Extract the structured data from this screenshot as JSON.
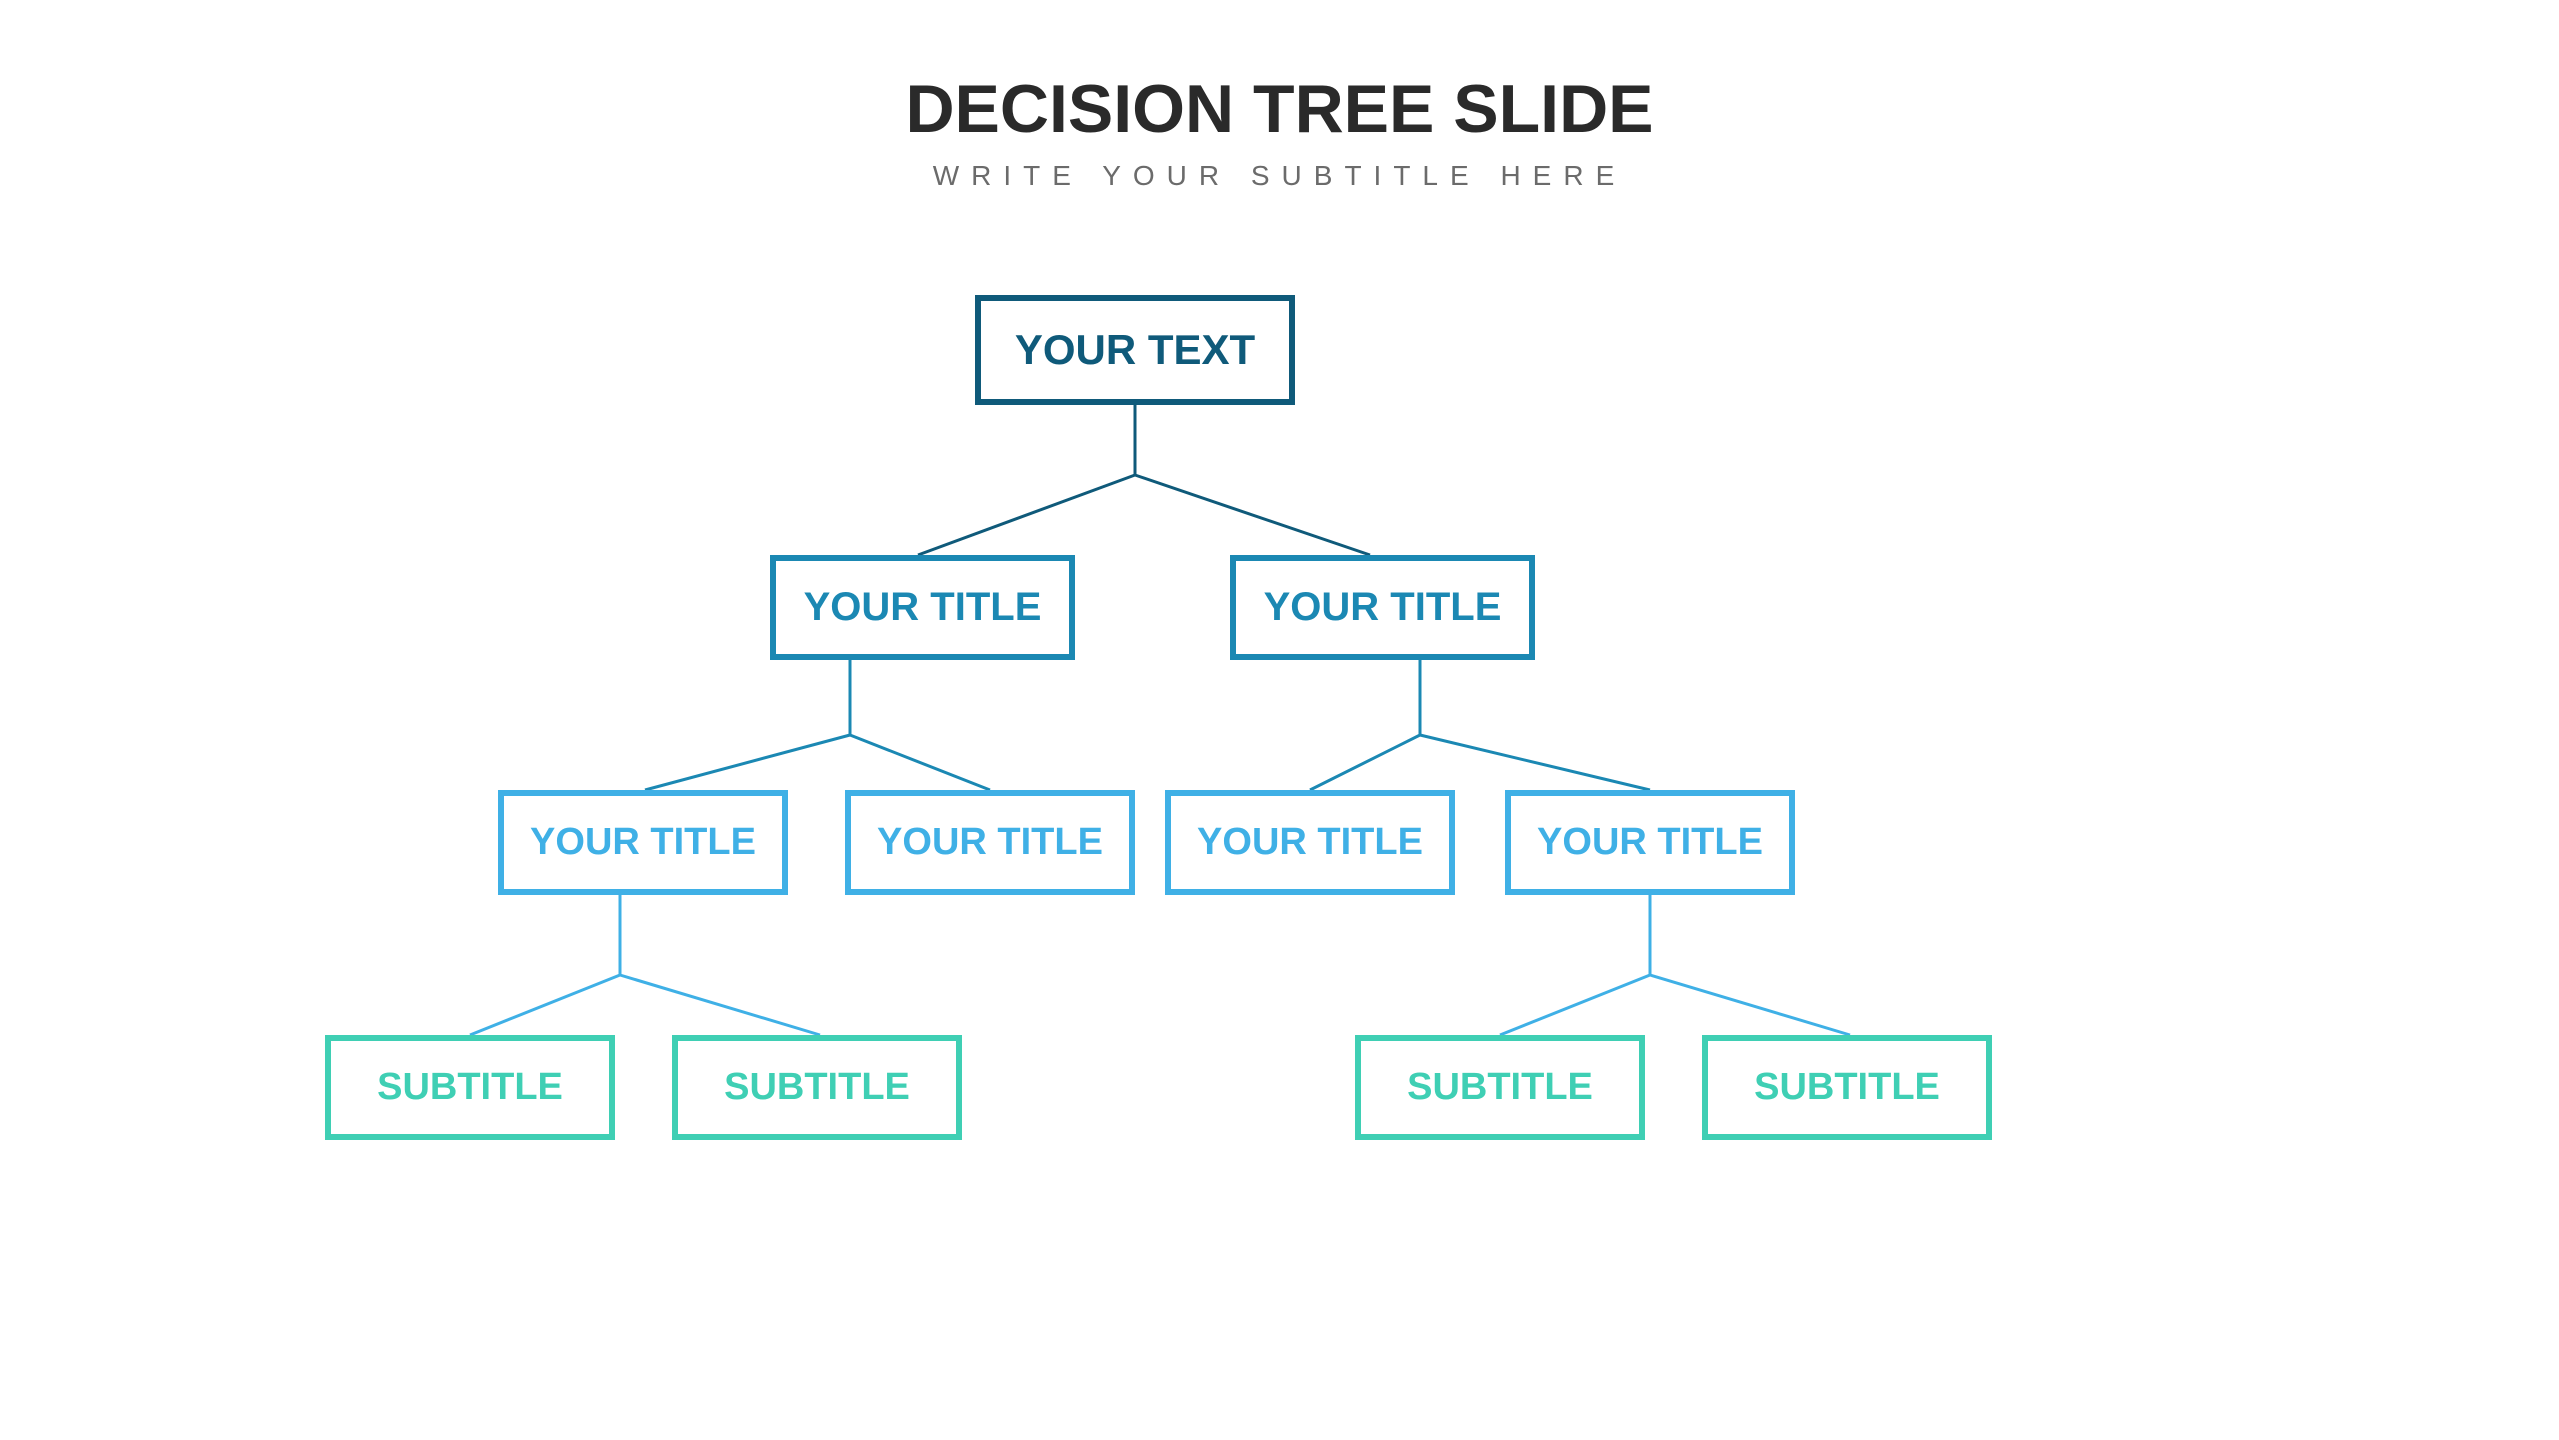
{
  "header": {
    "title": "DECISION TREE SLIDE",
    "subtitle": "WRITE YOUR SUBTITLE HERE"
  },
  "colors": {
    "level0": "#0f5a7a",
    "level1": "#1b88b3",
    "level2": "#3fb0e6",
    "level3": "#3fcfb4"
  },
  "tree": {
    "root": {
      "label": "YOUR TEXT"
    },
    "level1": [
      {
        "label": "YOUR TITLE"
      },
      {
        "label": "YOUR TITLE"
      }
    ],
    "level2": [
      {
        "label": "YOUR TITLE"
      },
      {
        "label": "YOUR TITLE"
      },
      {
        "label": "YOUR TITLE"
      },
      {
        "label": "YOUR TITLE"
      }
    ],
    "level3": [
      {
        "label": "SUBTITLE"
      },
      {
        "label": "SUBTITLE"
      },
      {
        "label": "SUBTITLE"
      },
      {
        "label": "SUBTITLE"
      }
    ]
  }
}
